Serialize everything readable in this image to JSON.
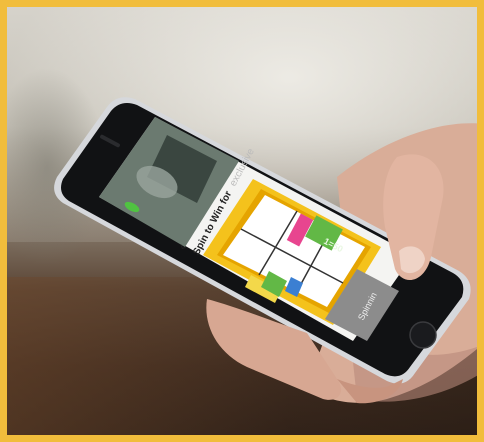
{
  "app": {
    "header_title": "Spin to Win for",
    "header_title_faded": "exclusive",
    "back_glyph": "‹",
    "prize_label": "1=50",
    "button_label": "Spinnin"
  },
  "colors": {
    "border": "#f1bd3c",
    "wheel_frame": "#f4c21c",
    "wheel_frame_dark": "#e5a400",
    "prize_green": "#62b846",
    "prize_pink": "#e8458f",
    "button_gray": "#8c8c8c"
  },
  "icons": [
    "chevron-left-icon",
    "bottle-icon",
    "glass-icon"
  ]
}
